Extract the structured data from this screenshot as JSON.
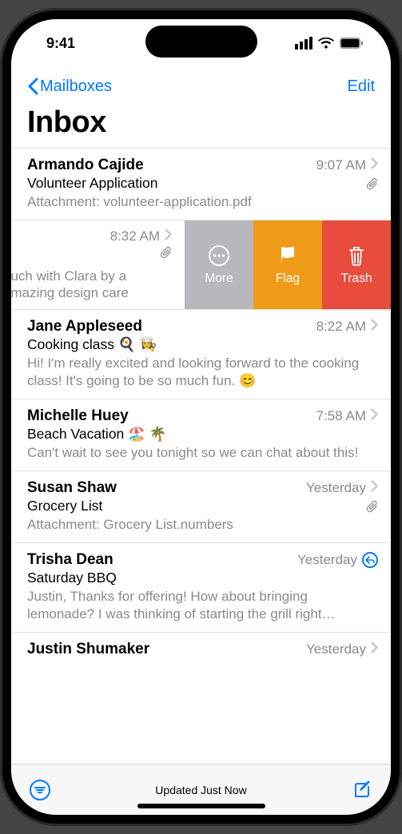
{
  "status": {
    "time": "9:41"
  },
  "nav": {
    "back": "Mailboxes",
    "edit": "Edit"
  },
  "title": "Inbox",
  "swipe": {
    "more": "More",
    "flag": "Flag",
    "trash": "Trash"
  },
  "messages": [
    {
      "sender": "Armando Cajide",
      "time": "9:07 AM",
      "subject": "Volunteer Application",
      "preview": "Attachment: volunteer-application.pdf",
      "attachment": true
    },
    {
      "sender": "",
      "time": "8:32 AM",
      "subject": "",
      "preview": "ouch with Clara by a\namazing design care",
      "attachment": true,
      "swiped": true
    },
    {
      "sender": "Jane Appleseed",
      "time": "8:22 AM",
      "subject": "Cooking class 🍳 👩‍🍳",
      "preview": "Hi! I'm really excited and looking forward to the cooking class! It's going to be so much fun. 😊"
    },
    {
      "sender": "Michelle Huey",
      "time": "7:58 AM",
      "subject": "Beach Vacation 🏖️ 🌴",
      "preview": "Can't wait to see you tonight so we can chat about this!"
    },
    {
      "sender": "Susan Shaw",
      "time": "Yesterday",
      "subject": "Grocery List",
      "preview": "Attachment: Grocery List.numbers",
      "attachment": true
    },
    {
      "sender": "Trisha Dean",
      "time": "Yesterday",
      "subject": "Saturday BBQ",
      "preview": "Justin, Thanks for offering! How about bringing lemonade? I was thinking of starting the grill right…",
      "replied": true
    },
    {
      "sender": "Justin Shumaker",
      "time": "Yesterday",
      "subject": "",
      "preview": ""
    }
  ],
  "toolbar": {
    "status": "Updated Just Now"
  }
}
